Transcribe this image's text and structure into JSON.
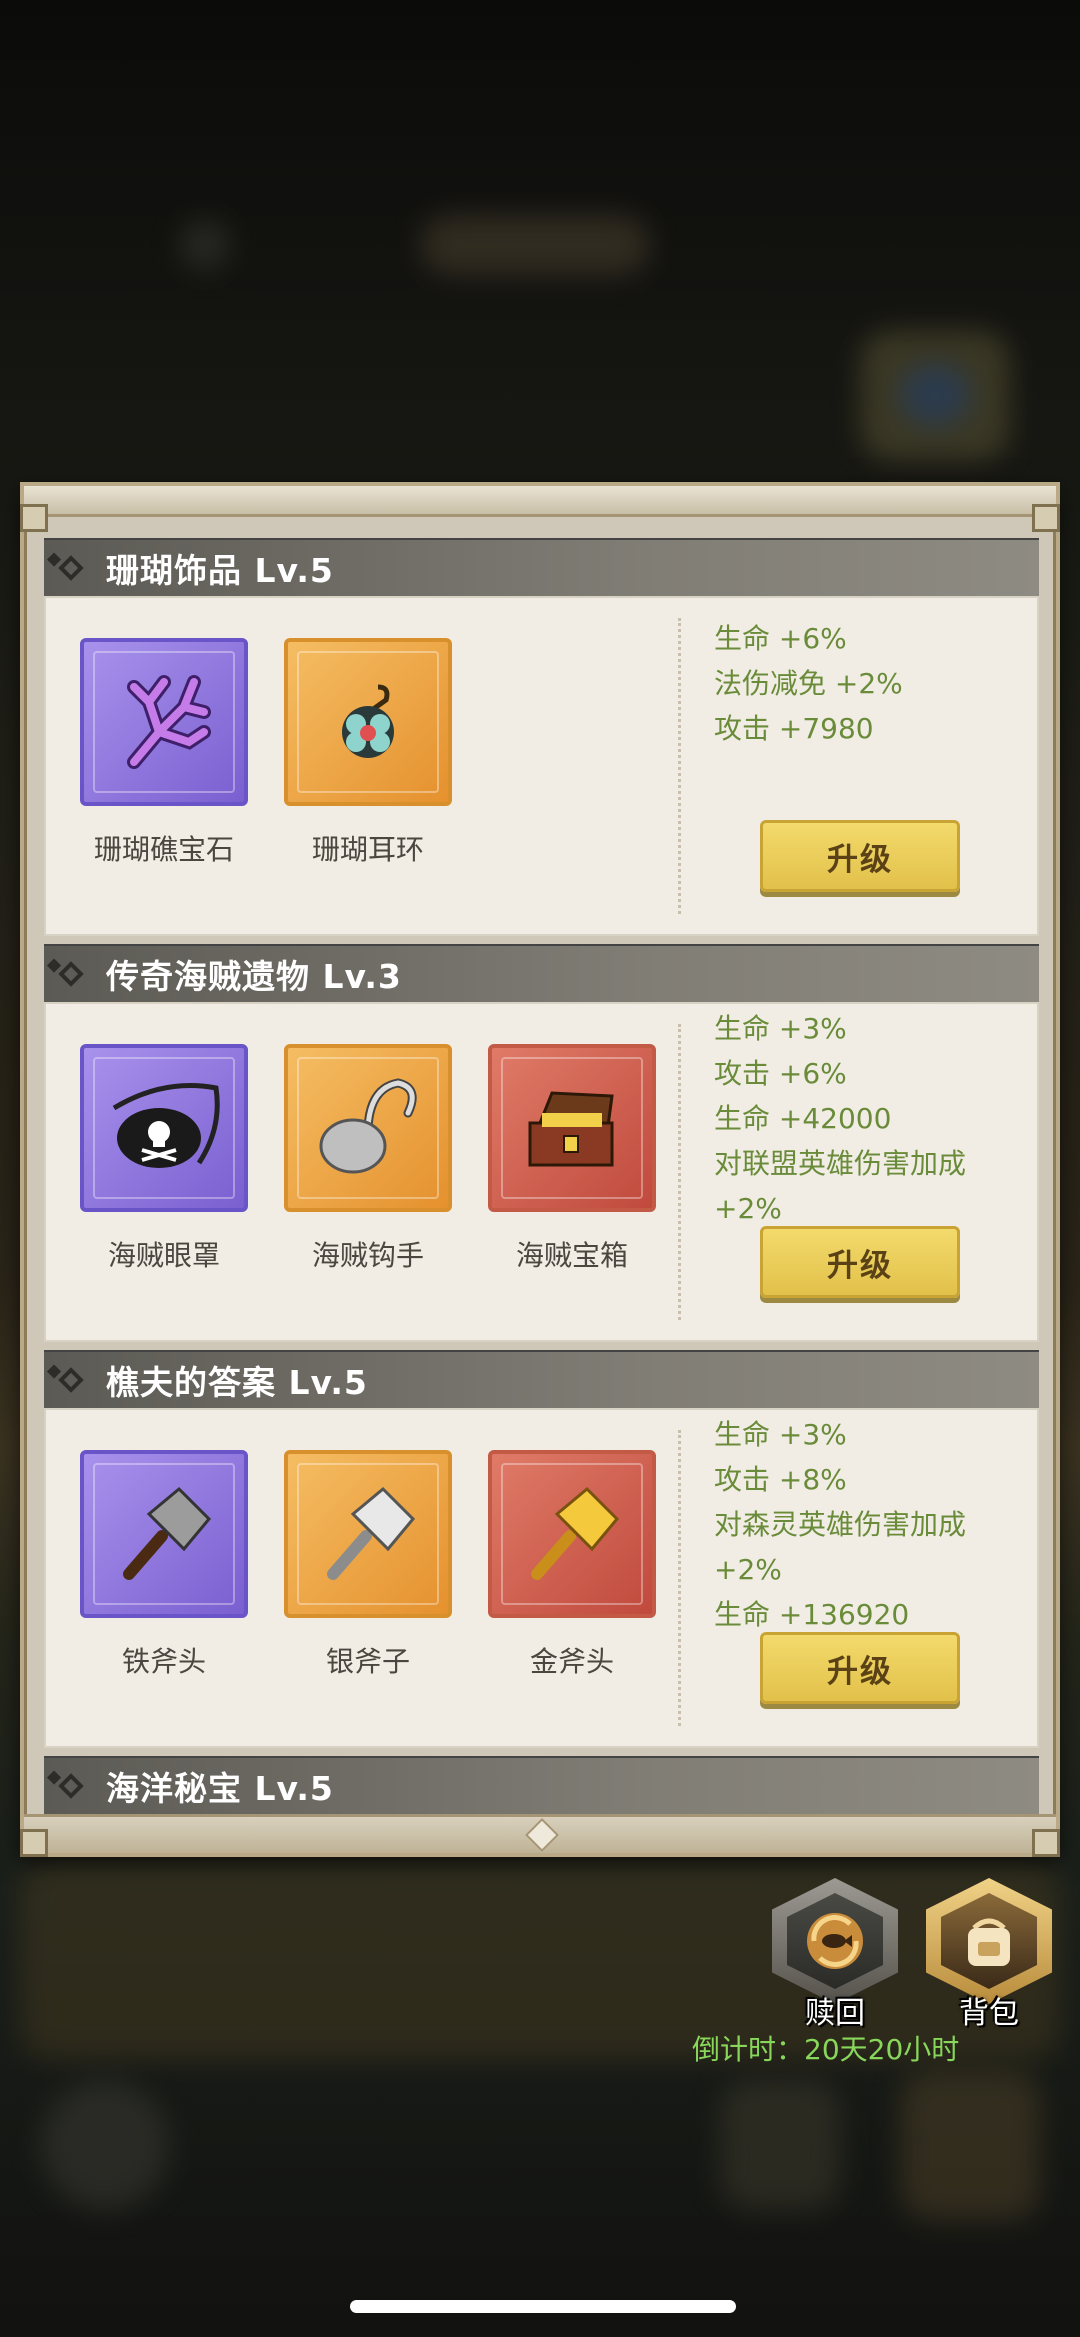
{
  "sections": [
    {
      "title": "珊瑚饰品 Lv.5",
      "items": [
        {
          "name": "珊瑚礁宝石",
          "rarity": "purple",
          "icon": "coral-icon"
        },
        {
          "name": "珊瑚耳环",
          "rarity": "orange",
          "icon": "earring-icon"
        }
      ],
      "stats": [
        "生命 +6%",
        "法伤减免 +2%",
        "攻击 +7980"
      ],
      "button": "升级"
    },
    {
      "title": "传奇海贼遗物 Lv.3",
      "items": [
        {
          "name": "海贼眼罩",
          "rarity": "purple",
          "icon": "eyepatch-icon"
        },
        {
          "name": "海贼钩手",
          "rarity": "orange",
          "icon": "hook-icon"
        },
        {
          "name": "海贼宝箱",
          "rarity": "red",
          "icon": "treasure-chest-icon"
        }
      ],
      "stats": [
        "生命 +3%",
        "攻击 +6%",
        "生命 +42000",
        "对联盟英雄伤害加成",
        "+2%"
      ],
      "button": "升级"
    },
    {
      "title": "樵夫的答案 Lv.5",
      "items": [
        {
          "name": "铁斧头",
          "rarity": "purple",
          "icon": "iron-axe-icon"
        },
        {
          "name": "银斧子",
          "rarity": "orange",
          "icon": "silver-axe-icon"
        },
        {
          "name": "金斧头",
          "rarity": "red",
          "icon": "gold-axe-icon"
        }
      ],
      "stats": [
        "生命 +3%",
        "攻击 +8%",
        "对森灵英雄伤害加成",
        "+2%",
        "生命 +136920"
      ],
      "button": "升级"
    },
    {
      "title": "海洋秘宝 Lv.5"
    }
  ],
  "actions": {
    "redeem": "赎回",
    "backpack": "背包"
  },
  "countdown": "倒计时：20天20小时",
  "colors": {
    "stat_text": "#6a8c3a",
    "button": "#e9c956",
    "countdown": "#88d65a"
  }
}
